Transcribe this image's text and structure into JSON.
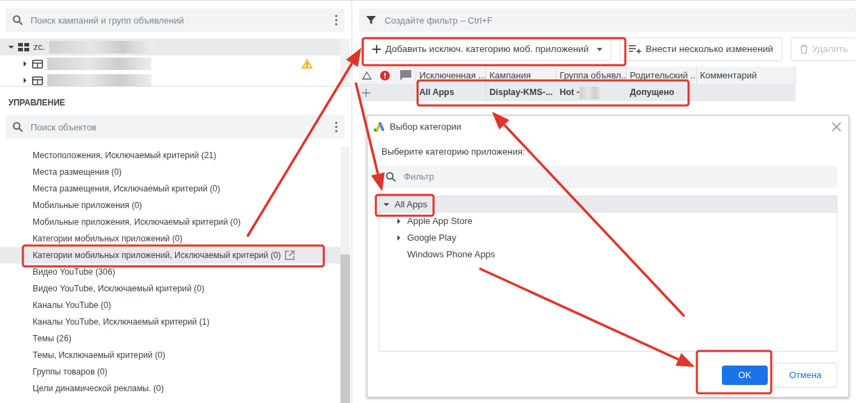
{
  "campaign_panel": {
    "search": {
      "placeholder": "Поиск кампаний и групп объявлений"
    },
    "tree": [
      {
        "label": "zc.",
        "expanded": true,
        "selected": true,
        "children": [
          {
            "expanded": false,
            "warning": true
          },
          {
            "expanded": false,
            "warning": false
          }
        ]
      }
    ]
  },
  "management": {
    "title": "УПРАВЛЕНИЕ",
    "search": {
      "placeholder": "Поиск объектов"
    },
    "items": [
      {
        "label": "Местоположения, Исключаемый критерий (21)",
        "selected": false
      },
      {
        "label": "Места размещения (0)",
        "selected": false
      },
      {
        "label": "Места размещения, Исключаемый критерий (0)",
        "selected": false
      },
      {
        "label": "Мобильные приложения (0)",
        "selected": false
      },
      {
        "label": "Мобильные приложения, Исключаемый критерий (0)",
        "selected": false
      },
      {
        "label": "Категории мобильных приложений (0)",
        "selected": false
      },
      {
        "label": "Категории мобильных приложений, Исключаемый критерий (0)",
        "selected": true
      },
      {
        "label": "Видео YouTube (306)",
        "selected": false
      },
      {
        "label": "Видео YouTube, Исключаемый критерий (0)",
        "selected": false
      },
      {
        "label": "Каналы YouTube (0)",
        "selected": false
      },
      {
        "label": "Каналы YouTube, Исключаемый критерий (1)",
        "selected": false
      },
      {
        "label": "Темы (26)",
        "selected": false
      },
      {
        "label": "Темы, Исключаемый критерий (0)",
        "selected": false
      },
      {
        "label": "Группы товаров (0)",
        "selected": false
      },
      {
        "label": "Цели динамической рекламы. (0)",
        "selected": false
      }
    ]
  },
  "filter_bar": {
    "placeholder": "Создайте фильтр – Ctrl+F"
  },
  "toolbar": [
    {
      "kind": "add",
      "label": "Добавить исключ. категорию моб. приложений",
      "disabled": false
    },
    {
      "kind": "bulk",
      "label": "Внести несколько изменений",
      "disabled": false
    },
    {
      "kind": "delete",
      "label": "Удалить",
      "disabled": true
    }
  ],
  "table": {
    "columns": [
      {
        "kind": "status-icon"
      },
      {
        "kind": "error-icon"
      },
      {
        "kind": "comment-icon"
      },
      {
        "kind": "text",
        "label": "Исключенная ..."
      },
      {
        "kind": "text",
        "label": "Кампания"
      },
      {
        "kind": "text",
        "label": "Группа объявл..."
      },
      {
        "kind": "text",
        "label": "Родительский ..."
      },
      {
        "kind": "text",
        "label": "Комментарий"
      }
    ],
    "rows": [
      {
        "selected": true,
        "cells": [
          "",
          "",
          "",
          "All Apps",
          "Display-KMS-...",
          "Hot - ",
          "Допущено"
        ]
      }
    ]
  },
  "dialog": {
    "title": "Выбор категории",
    "prompt": "Выберите категорию приложения:",
    "filter": {
      "placeholder": "Фильтр"
    },
    "tree": [
      {
        "label": "All Apps",
        "expanded": true,
        "selected": true,
        "children": [
          {
            "label": "Apple App Store",
            "has_children": true,
            "selected": false
          },
          {
            "label": "Google Play",
            "has_children": true,
            "selected": false
          },
          {
            "label": "Windows Phone Apps",
            "has_children": false,
            "selected": false
          }
        ]
      }
    ],
    "buttons": [
      {
        "kind": "primary",
        "label": "OK"
      },
      {
        "kind": "secondary",
        "label": "Отмена"
      }
    ]
  }
}
